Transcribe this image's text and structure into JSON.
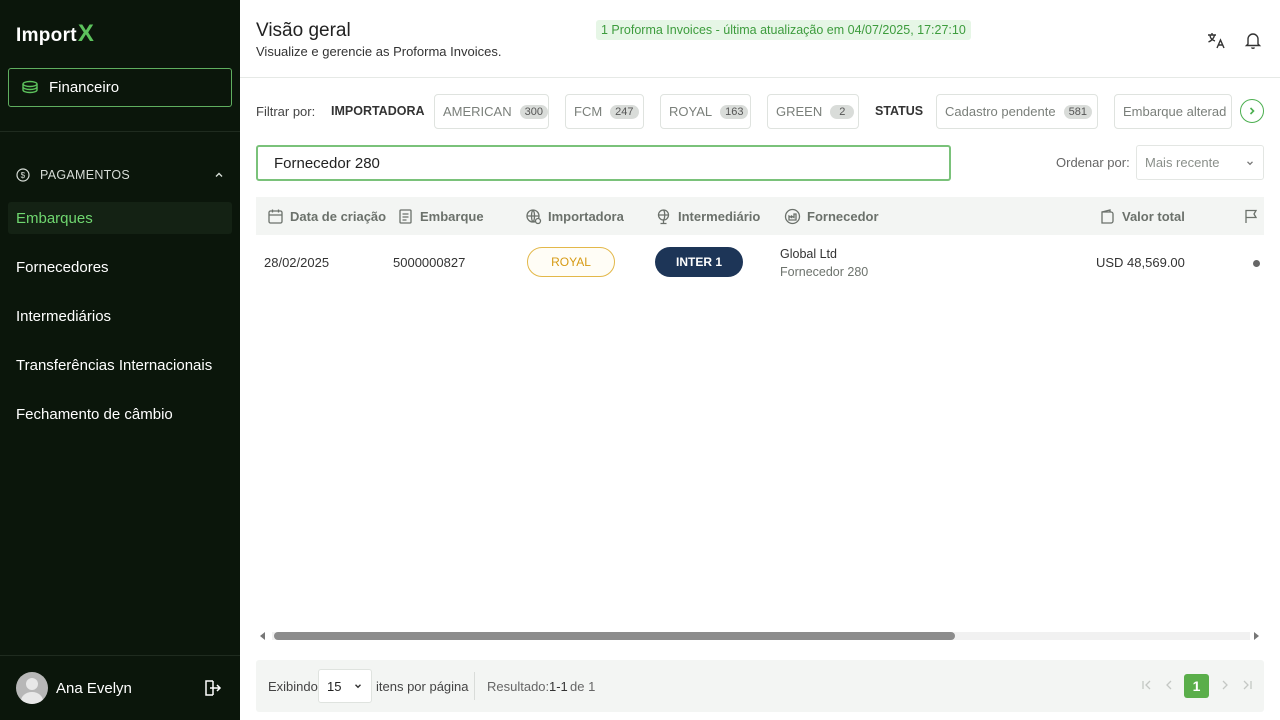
{
  "app": {
    "logo_text": "Import",
    "logo_accent": "X"
  },
  "sidebar": {
    "module_label": "Financeiro",
    "section_label": "PAGAMENTOS",
    "items": [
      {
        "label": "Embarques",
        "active": true
      },
      {
        "label": "Fornecedores"
      },
      {
        "label": "Intermediários"
      },
      {
        "label": "Transferências Internacionais"
      },
      {
        "label": "Fechamento de câmbio"
      }
    ],
    "user_name": "Ana Evelyn"
  },
  "header": {
    "title": "Visão geral",
    "update_badge": "1 Proforma Invoices - última atualização em 04/07/2025, 17:27:10",
    "subtitle": "Visualize e gerencie as Proforma Invoices."
  },
  "filters": {
    "label": "Filtrar por:",
    "importadora_label": "IMPORTADORA",
    "importadoras": [
      {
        "name": "AMERICAN",
        "count": "300"
      },
      {
        "name": "FCM",
        "count": "247"
      },
      {
        "name": "ROYAL",
        "count": "163"
      },
      {
        "name": "GREEN",
        "count": "2"
      }
    ],
    "status_label": "STATUS",
    "statuses": [
      {
        "name": "Cadastro pendente",
        "count": "581"
      },
      {
        "name": "Embarque alterad"
      }
    ]
  },
  "search": {
    "value": "Fornecedor 280"
  },
  "sort": {
    "label": "Ordenar por:",
    "value": "Mais recente"
  },
  "table": {
    "columns": [
      "Data de criação",
      "Embarque",
      "Importadora",
      "Intermediário",
      "Fornecedor",
      "Valor total"
    ],
    "rows": [
      {
        "date": "28/02/2025",
        "embarque": "5000000827",
        "importadora": "ROYAL",
        "intermediario": "INTER 1",
        "fornecedor_company": "Global Ltd",
        "fornecedor_name": "Fornecedor 280",
        "valor_total": "USD 48,569.00"
      }
    ]
  },
  "pagination": {
    "showing_label": "Exibindo",
    "per_page": "15",
    "per_page_label": "itens por página",
    "result_label": "Resultado:",
    "result_range": "1-1",
    "result_of": "de 1",
    "current_page": "1"
  },
  "colors": {
    "sidebar_bg": "#0b160b",
    "accent_green": "#5aae4a",
    "royal_gold": "#d69a14",
    "inter_navy": "#1d3557"
  }
}
